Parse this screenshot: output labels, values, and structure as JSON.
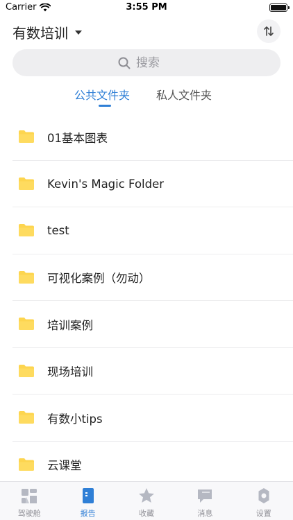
{
  "status_bar": {
    "carrier": "Carrier",
    "time": "3:55 PM"
  },
  "header": {
    "org_title": "有数培训"
  },
  "search": {
    "placeholder": "搜索"
  },
  "tabs": [
    {
      "label": "公共文件夹",
      "active": true
    },
    {
      "label": "私人文件夹",
      "active": false
    }
  ],
  "folders": [
    {
      "name": "01基本图表"
    },
    {
      "name": "Kevin's Magic Folder"
    },
    {
      "name": "test"
    },
    {
      "name": "可视化案例（勿动）"
    },
    {
      "name": "培训案例"
    },
    {
      "name": "现场培训"
    },
    {
      "name": "有数小tips"
    },
    {
      "name": "云课堂"
    }
  ],
  "tab_bar": [
    {
      "label": "驾驶舱",
      "icon": "cockpit-icon",
      "active": false
    },
    {
      "label": "报告",
      "icon": "report-icon",
      "active": true
    },
    {
      "label": "收藏",
      "icon": "star-icon",
      "active": false
    },
    {
      "label": "消息",
      "icon": "message-icon",
      "active": false
    },
    {
      "label": "设置",
      "icon": "gear-icon",
      "active": false
    }
  ],
  "colors": {
    "accent": "#2f7fd6",
    "folder": "#fdd54f",
    "inactive_icon": "#b5b8c2"
  }
}
